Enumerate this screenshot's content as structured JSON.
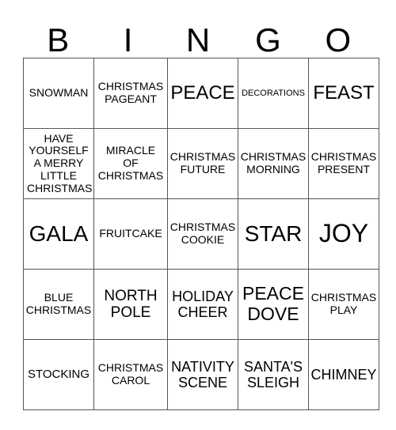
{
  "header": {
    "letters": [
      "B",
      "I",
      "N",
      "G",
      "O"
    ]
  },
  "grid": {
    "rows": [
      [
        "SNOWMAN",
        "CHRISTMAS PAGEANT",
        "PEACE",
        "DECORATIONS",
        "FEAST"
      ],
      [
        "HAVE YOURSELF A MERRY LITTLE CHRISTMAS",
        "MIRACLE OF CHRISTMAS",
        "CHRISTMAS FUTURE",
        "CHRISTMAS MORNING",
        "CHRISTMAS PRESENT"
      ],
      [
        "GALA",
        "FRUITCAKE",
        "CHRISTMAS COOKIE",
        "STAR",
        "JOY"
      ],
      [
        "BLUE CHRISTMAS",
        "NORTH POLE",
        "HOLIDAY CHEER",
        "PEACE DOVE",
        "CHRISTMAS PLAY"
      ],
      [
        "STOCKING",
        "CHRISTMAS CAROL",
        "NATIVITY SCENE",
        "SANTA'S SLEIGH",
        "CHIMNEY"
      ]
    ]
  }
}
